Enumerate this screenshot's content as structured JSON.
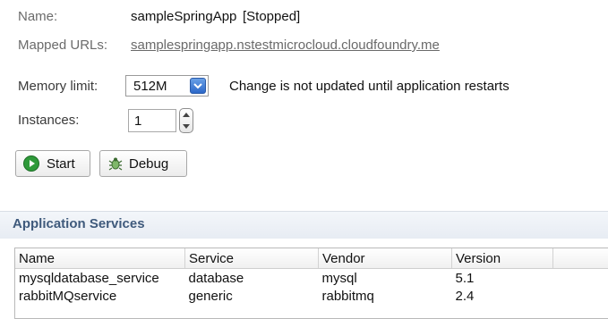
{
  "app": {
    "name_label": "Name:",
    "name_value": "sampleSpringApp",
    "status": "[Stopped]",
    "urls_label": "Mapped URLs:",
    "url": "samplespringapp.nstestmicrocloud.cloudfoundry.me",
    "memory_label": "Memory limit:",
    "memory_value": "512M",
    "memory_note": "Change is not updated until application restarts",
    "instances_label": "Instances:",
    "instances_value": "1"
  },
  "actions": {
    "start_label": "Start",
    "debug_label": "Debug"
  },
  "services": {
    "title": "Application Services",
    "columns": [
      "Name",
      "Service",
      "Vendor",
      "Version"
    ],
    "rows": [
      [
        "mysqldatabase_service",
        "database",
        "mysql",
        "5.1"
      ],
      [
        "rabbitMQservice",
        "generic",
        "rabbitmq",
        "2.4"
      ]
    ]
  },
  "colors": {
    "section_title": "#3f5a7c",
    "combo_button": "#2c68c9",
    "start_icon": "#2f9a3a"
  }
}
